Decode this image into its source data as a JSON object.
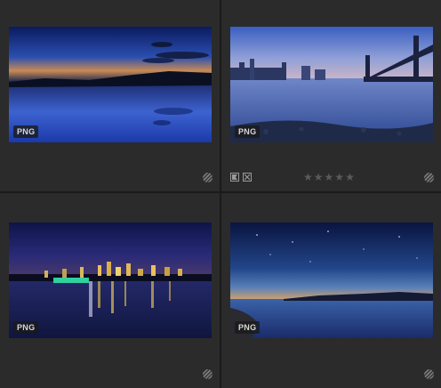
{
  "grid": {
    "cells": [
      {
        "name": "thumb-night-lake",
        "badge": "PNG"
      },
      {
        "name": "thumb-bridge-skyline",
        "badge": "PNG",
        "rating": 0,
        "stars": [
          "★",
          "★",
          "★",
          "★",
          "★"
        ]
      },
      {
        "name": "thumb-city-reflection",
        "badge": "PNG"
      },
      {
        "name": "thumb-starry-coast",
        "badge": "PNG"
      }
    ]
  },
  "icons": {
    "resize": "resize-handle-icon",
    "flag_pick": "flag-pick-icon",
    "flag_reject": "flag-reject-icon",
    "star": "star-icon"
  },
  "colors": {
    "background": "#2b2b2b",
    "divider": "#1a1a1a",
    "star_inactive": "#5a5a5a"
  }
}
